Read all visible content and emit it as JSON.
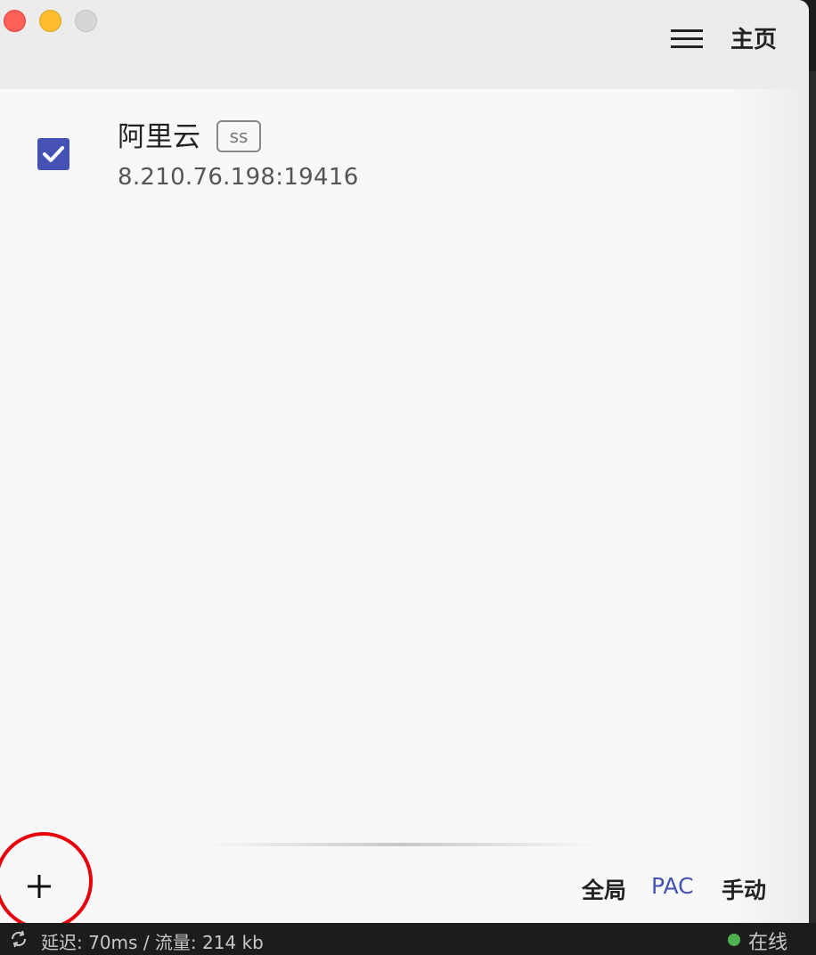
{
  "window": {
    "title": "主页",
    "traffic_lights": [
      "close",
      "minimize",
      "maximize"
    ]
  },
  "header": {
    "menu_icon": "hamburger-icon",
    "title": "主页"
  },
  "servers": [
    {
      "name": "阿里云",
      "type": "ss",
      "address": "8.210.76.198:19416",
      "selected": true
    }
  ],
  "footer": {
    "add_icon": "plus-icon",
    "modes": {
      "global": "全局",
      "pac": "PAC",
      "manual": "手动",
      "active": "PAC"
    }
  },
  "statusbar": {
    "refresh_icon": "refresh-icon",
    "latency_label": "延迟",
    "latency_value": "70ms",
    "traffic_label": "流量",
    "traffic_value": "214 kb",
    "text": "延迟: 70ms  /  流量: 214 kb",
    "online_label": "在线",
    "online_color": "#4caf50"
  },
  "colors": {
    "accent": "#4552b4",
    "highlight": "#e8000b"
  }
}
